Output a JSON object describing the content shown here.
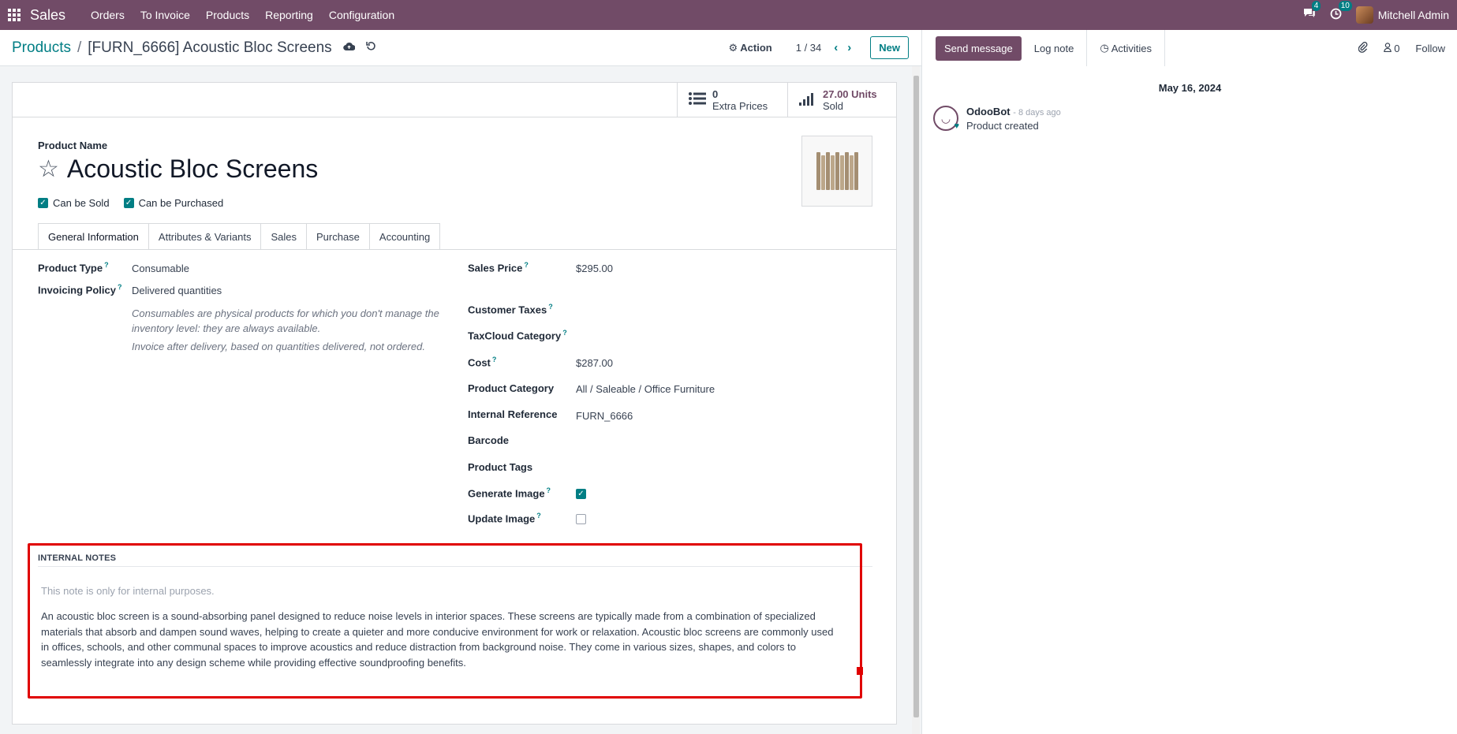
{
  "navbar": {
    "app": "Sales",
    "menu": [
      "Orders",
      "To Invoice",
      "Products",
      "Reporting",
      "Configuration"
    ],
    "messages_count": "4",
    "activities_count": "10",
    "user": "Mitchell Admin"
  },
  "control": {
    "breadcrumb_parent": "Products",
    "breadcrumb_current": "[FURN_6666] Acoustic Bloc Screens",
    "action_label": "Action",
    "pager": "1 / 34",
    "new_label": "New"
  },
  "stats": {
    "extra_prices_value": "0",
    "extra_prices_label": "Extra Prices",
    "sold_value": "27.00 Units",
    "sold_label": "Sold"
  },
  "product": {
    "name_label": "Product Name",
    "name": "Acoustic Bloc Screens",
    "can_be_sold_label": "Can be Sold",
    "can_be_purchased_label": "Can be Purchased"
  },
  "tabs": [
    "General Information",
    "Attributes & Variants",
    "Sales",
    "Purchase",
    "Accounting"
  ],
  "left_fields": {
    "product_type_label": "Product Type",
    "product_type": "Consumable",
    "invoicing_policy_label": "Invoicing Policy",
    "invoicing_policy": "Delivered quantities",
    "help_consumable": "Consumables are physical products for which you don't manage the inventory level: they are always available.",
    "help_invoice": "Invoice after delivery, based on quantities delivered, not ordered."
  },
  "right_fields": {
    "sales_price_label": "Sales Price",
    "sales_price": "$295.00",
    "customer_taxes_label": "Customer Taxes",
    "taxcloud_label": "TaxCloud Category",
    "cost_label": "Cost",
    "cost": "$287.00",
    "category_label": "Product Category",
    "category": "All / Saleable / Office Furniture",
    "internal_ref_label": "Internal Reference",
    "internal_ref": "FURN_6666",
    "barcode_label": "Barcode",
    "tags_label": "Product Tags",
    "generate_image_label": "Generate Image",
    "update_image_label": "Update Image"
  },
  "notes": {
    "title": "INTERNAL NOTES",
    "placeholder": "This note is only for internal purposes.",
    "text": "An acoustic bloc screen is a sound-absorbing panel designed to reduce noise levels in interior spaces. These screens are typically made from a combination of specialized materials that absorb and dampen sound waves, helping to create a quieter and more conducive environment for work or relaxation. Acoustic bloc screens are commonly used in offices, schools, and other communal spaces to improve acoustics and reduce distraction from background noise. They come in various sizes, shapes, and colors to seamlessly integrate into any design scheme while providing effective soundproofing benefits."
  },
  "chatter": {
    "send_message": "Send message",
    "log_note": "Log note",
    "activities": "Activities",
    "followers_count": "0",
    "follow": "Follow",
    "date": "May 16, 2024",
    "author": "OdooBot",
    "time": "- 8 days ago",
    "body": "Product created"
  },
  "colors": {
    "brand": "#714b67",
    "accent": "#017e84",
    "highlight": "#e00000"
  }
}
